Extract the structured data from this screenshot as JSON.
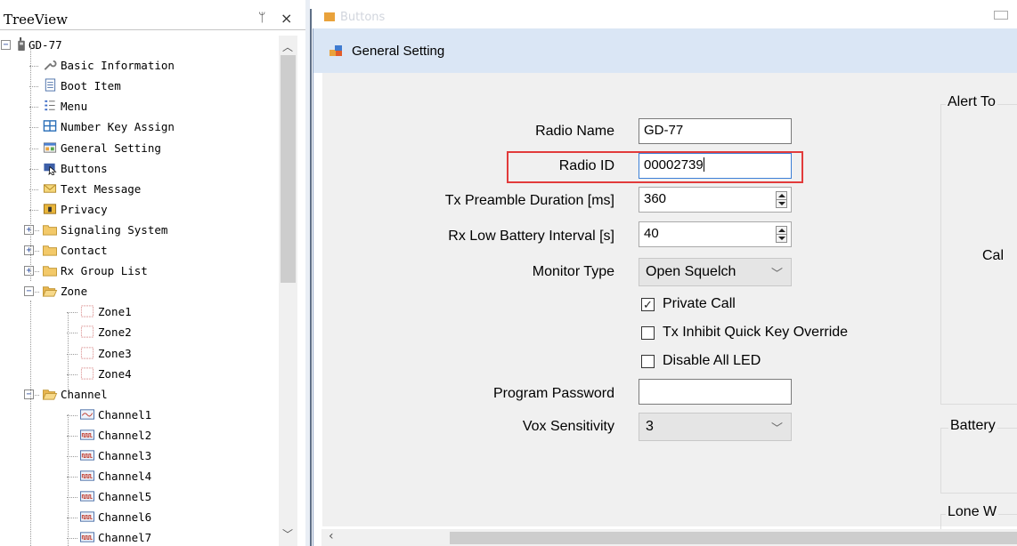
{
  "treeview": {
    "title": "TreeView",
    "pin_glyph": "📌",
    "close_glyph": "×",
    "items": [
      {
        "label": "GD-77",
        "icon": "radio-icon"
      },
      {
        "label": "Basic Information",
        "icon": "wrench-icon"
      },
      {
        "label": "Boot Item",
        "icon": "document-icon"
      },
      {
        "label": "Menu",
        "icon": "menu-list-icon"
      },
      {
        "label": "Number Key Assign",
        "icon": "keypad-icon"
      },
      {
        "label": "General Setting",
        "icon": "settings-icon"
      },
      {
        "label": "Buttons",
        "icon": "cursor-button-icon"
      },
      {
        "label": "Text Message",
        "icon": "envelope-icon"
      },
      {
        "label": "Privacy",
        "icon": "privacy-icon"
      },
      {
        "label": "Signaling System",
        "icon": "folder-icon"
      },
      {
        "label": "Contact",
        "icon": "folder-icon"
      },
      {
        "label": "Rx Group List",
        "icon": "folder-icon"
      },
      {
        "label": "Zone",
        "icon": "folder-open-icon"
      },
      {
        "label": "Zone1",
        "icon": "zone-icon"
      },
      {
        "label": "Zone2",
        "icon": "zone-icon"
      },
      {
        "label": "Zone3",
        "icon": "zone-icon"
      },
      {
        "label": "Zone4",
        "icon": "zone-icon"
      },
      {
        "label": "Channel",
        "icon": "folder-open-icon"
      },
      {
        "label": "Channel1",
        "icon": "analog-channel-icon"
      },
      {
        "label": "Channel2",
        "icon": "digital-channel-icon"
      },
      {
        "label": "Channel3",
        "icon": "digital-channel-icon"
      },
      {
        "label": "Channel4",
        "icon": "digital-channel-icon"
      },
      {
        "label": "Channel5",
        "icon": "digital-channel-icon"
      },
      {
        "label": "Channel6",
        "icon": "digital-channel-icon"
      },
      {
        "label": "Channel7",
        "icon": "digital-channel-icon"
      }
    ]
  },
  "buttons_window": {
    "title": "Buttons"
  },
  "general_setting": {
    "title": "General Setting",
    "radio_name": {
      "label": "Radio Name",
      "value": "GD-77"
    },
    "radio_id": {
      "label": "Radio ID",
      "value": "00002739"
    },
    "tx_preamble": {
      "label": "Tx Preamble Duration [ms]",
      "value": "360"
    },
    "rx_low_battery": {
      "label": "Rx Low Battery Interval [s]",
      "value": "40"
    },
    "monitor_type": {
      "label": "Monitor Type",
      "value": "Open Squelch"
    },
    "private_call": {
      "label": "Private Call",
      "checked": true
    },
    "tx_inhibit": {
      "label": "Tx Inhibit Quick Key Override",
      "checked": false
    },
    "disable_led": {
      "label": "Disable All LED",
      "checked": false
    },
    "program_password": {
      "label": "Program Password",
      "value": ""
    },
    "vox_sensitivity": {
      "label": "Vox Sensitivity",
      "value": "3"
    },
    "groups": {
      "alert_tone": "Alert To",
      "call": "Cal",
      "battery": "Battery",
      "lone_worker": "Lone W"
    }
  },
  "colors": {
    "highlight": "#e23b3b",
    "title_bar": "#dae6f5",
    "form_bg": "#f0f0f0"
  }
}
